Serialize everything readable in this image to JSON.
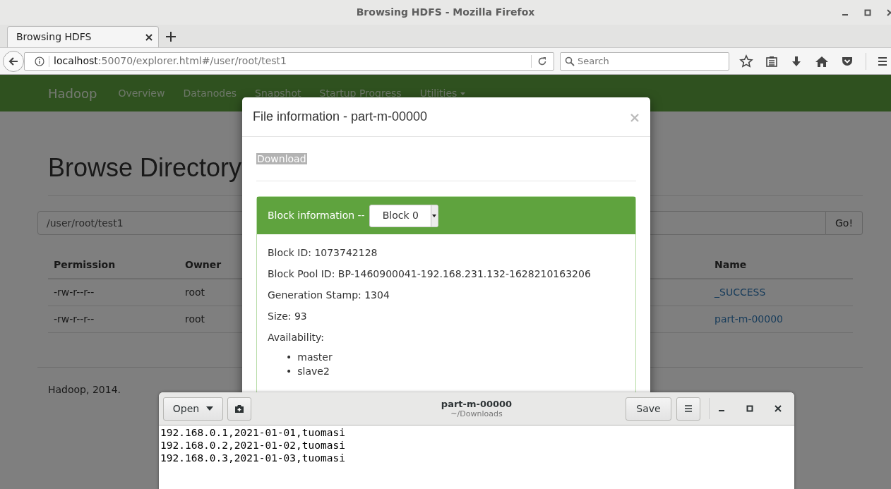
{
  "window": {
    "title": "Browsing HDFS - Mozilla Firefox"
  },
  "browser_tabs": [
    {
      "label": "Browsing HDFS",
      "selected": true
    }
  ],
  "address_bar": {
    "host": "localhost",
    "path": ":50070/explorer.html#/user/root/test1"
  },
  "search": {
    "placeholder": "Search"
  },
  "navbar": {
    "brand": "Hadoop",
    "items": [
      {
        "label": "Overview",
        "dropdown": false
      },
      {
        "label": "Datanodes",
        "dropdown": false
      },
      {
        "label": "Snapshot",
        "dropdown": false
      },
      {
        "label": "Startup Progress",
        "dropdown": false
      },
      {
        "label": "Utilities",
        "dropdown": true
      }
    ]
  },
  "page": {
    "heading": "Browse Directory",
    "path_value": "/user/root/test1",
    "go_button": "Go!",
    "columns": [
      "Permission",
      "Owner",
      "Name"
    ],
    "rows": [
      {
        "permission": "-rw-r--r--",
        "owner": "root",
        "name": "_SUCCESS"
      },
      {
        "permission": "-rw-r--r--",
        "owner": "root",
        "name": "part-m-00000"
      }
    ],
    "footer": "Hadoop, 2014."
  },
  "modal": {
    "title": "File information - part-m-00000",
    "download": "Download",
    "block_heading": "Block information --",
    "block_select": "Block 0",
    "fields": [
      "Block ID: 1073742128",
      "Block Pool ID: BP-1460900041-192.168.231.132-1628210163206",
      "Generation Stamp: 1304",
      "Size: 93"
    ],
    "availability_label": "Availability:",
    "hosts": [
      {
        "bullet": "•",
        "name": "master"
      },
      {
        "bullet": "•",
        "name": "slave2"
      }
    ]
  },
  "editor": {
    "open_button": "Open",
    "title": "part-m-00000",
    "subtitle": "~/Downloads",
    "save_button": "Save",
    "lines": [
      "192.168.0.1,2021-01-01,tuomasi",
      "192.168.0.2,2021-01-02,tuomasi",
      "192.168.0.3,2021-01-03,tuomasi"
    ]
  }
}
